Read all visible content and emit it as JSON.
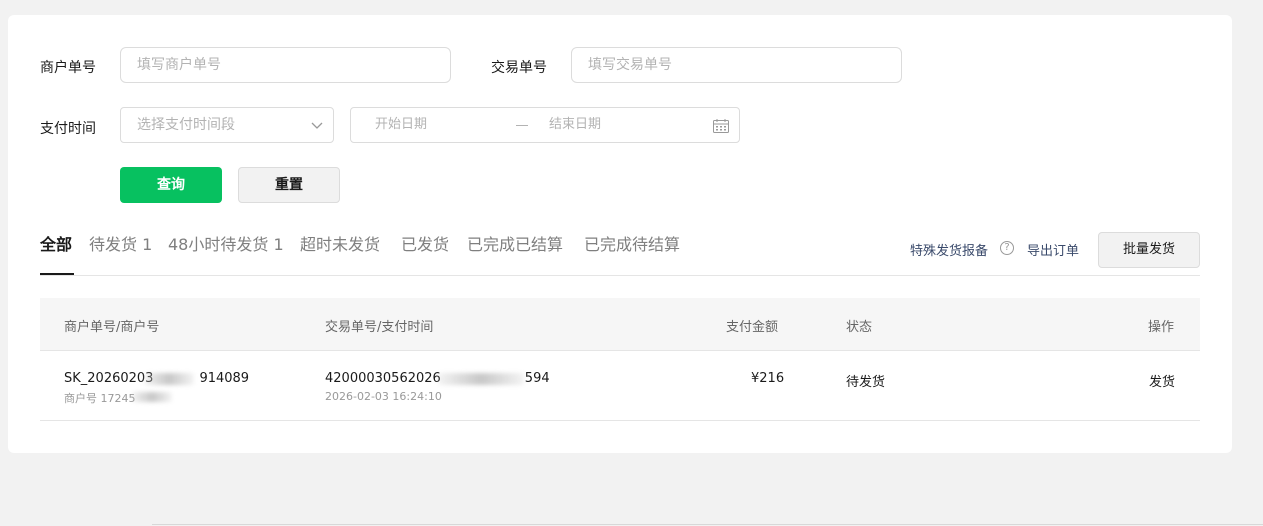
{
  "filters": {
    "merchant_no_label": "商户单号",
    "merchant_no_placeholder": "填写商户单号",
    "trade_no_label": "交易单号",
    "trade_no_placeholder": "填写交易单号",
    "pay_time_label": "支付时间",
    "pay_time_select_placeholder": "选择支付时间段",
    "start_date_placeholder": "开始日期",
    "end_date_placeholder": "结束日期",
    "query_button": "查询",
    "reset_button": "重置"
  },
  "tabs": [
    {
      "label": "全部",
      "active": true
    },
    {
      "label": "待发货 1",
      "active": false
    },
    {
      "label": "48小时待发货 1",
      "active": false
    },
    {
      "label": "超时未发货",
      "active": false
    },
    {
      "label": "已发货",
      "active": false
    },
    {
      "label": "已完成已结算",
      "active": false
    },
    {
      "label": "已完成待结算",
      "active": false
    }
  ],
  "actions": {
    "special_shipping_report": "特殊发货报备",
    "help_icon_glyph": "?",
    "export_orders": "导出订单",
    "batch_ship": "批量发货"
  },
  "table": {
    "columns": [
      "商户单号/商户号",
      "交易单号/支付时间",
      "支付金额",
      "状态",
      "操作"
    ],
    "rows": [
      {
        "merchant_order_no": "SK_20260203",
        "merchant_order_no_tail": "914089",
        "merchant_id": "商户号 17245",
        "trade_no": "42000030562026",
        "trade_no_tail": "594",
        "pay_time": "2026-02-03 16:24:10",
        "amount": "¥216",
        "status": "待发货",
        "action": "发货"
      }
    ]
  },
  "icons": {
    "select_chevron": "chevron-down-icon",
    "date_picker": "calendar-icon",
    "help": "question-circle-icon"
  },
  "colors": {
    "primary": "#07c160",
    "link": "#576b95",
    "page_bg": "#f2f2f2"
  }
}
